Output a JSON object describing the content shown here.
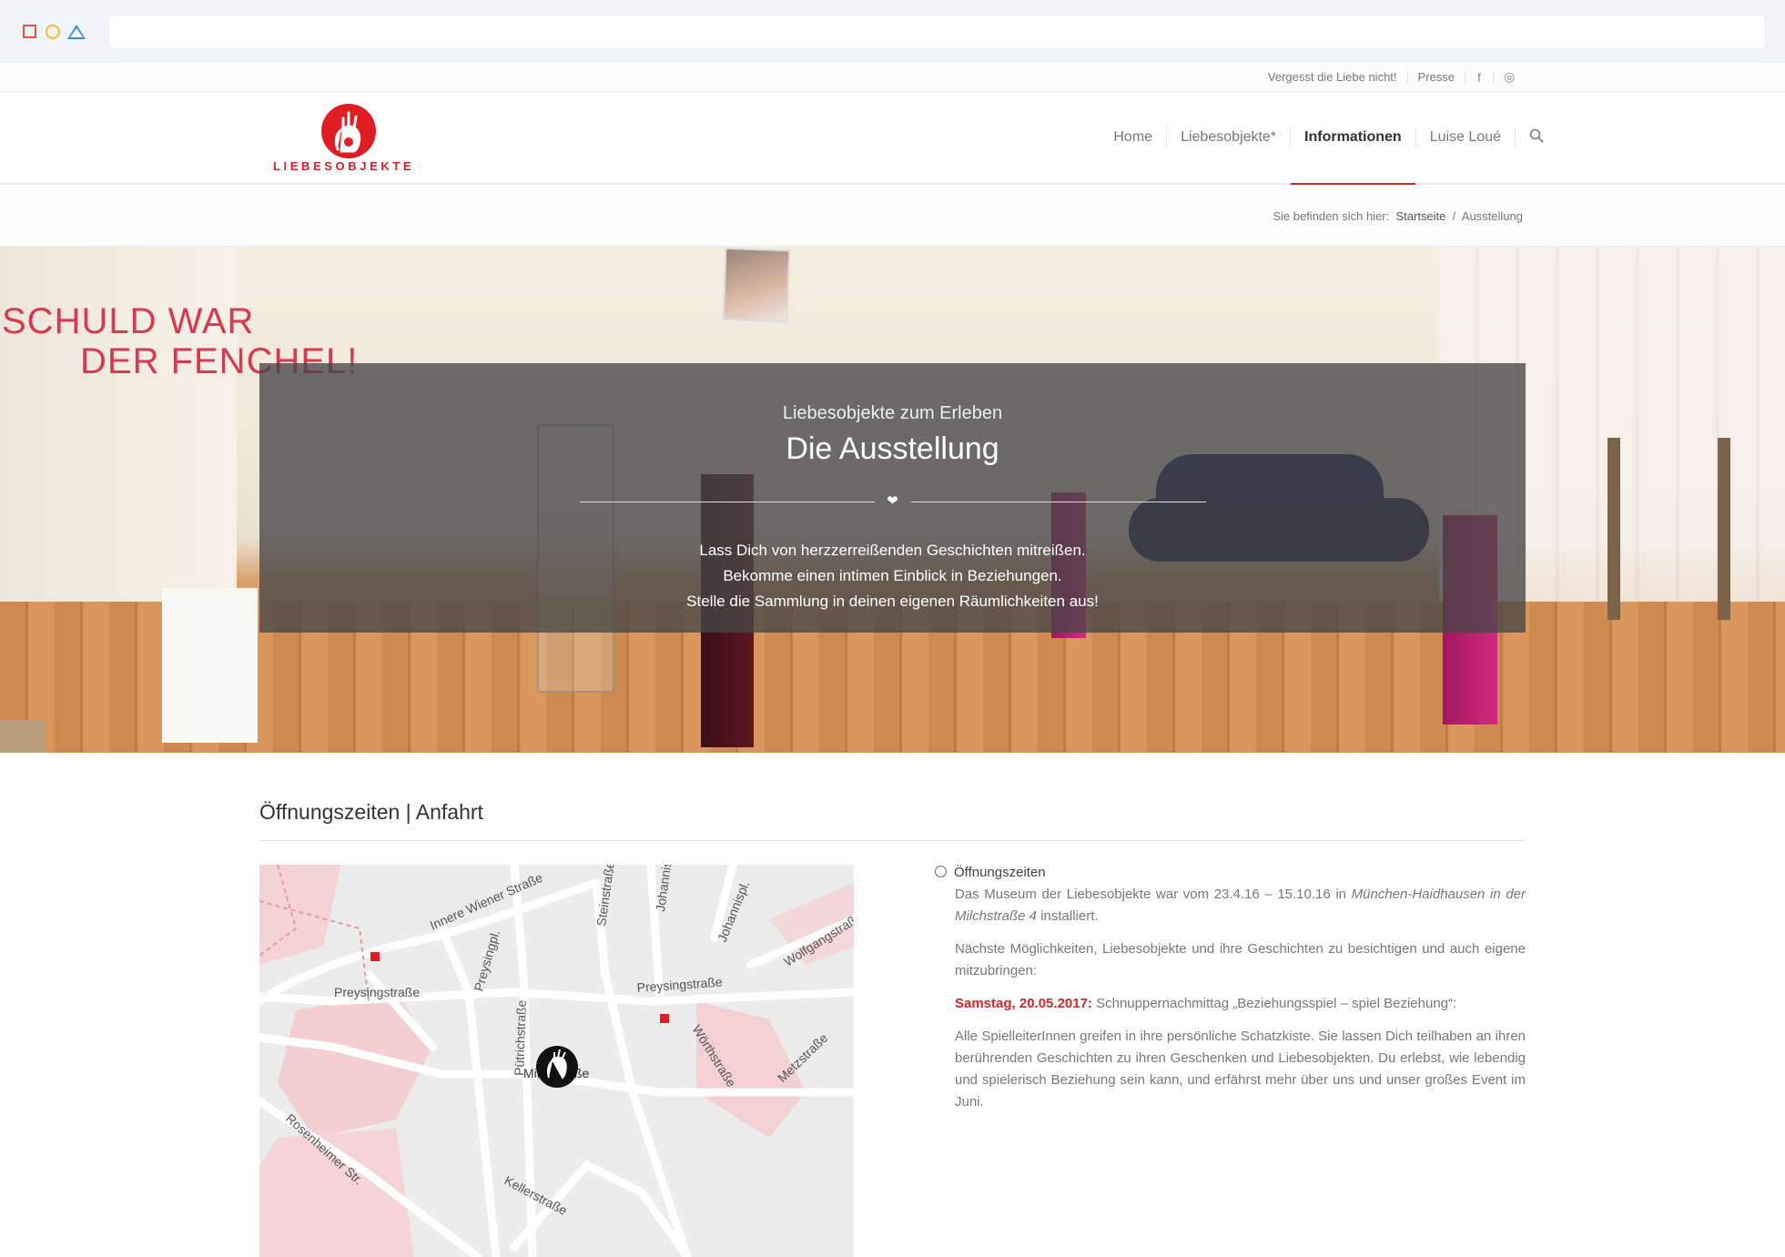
{
  "topbar": {
    "link1": "Vergesst die Liebe nicht!",
    "link2": "Presse",
    "fb": "f",
    "ig": "◎"
  },
  "logo": {
    "text": "LIEBESOBJEKTE"
  },
  "nav": {
    "home": "Home",
    "liebesobjekte": "Liebesobjekte*",
    "informationen": "Informationen",
    "luise": "Luise Loué",
    "search": "⚲"
  },
  "breadcrumb": {
    "prefix": "Sie befinden sich hier:",
    "home": "Startseite",
    "sep": "/",
    "current": "Ausstellung"
  },
  "hero": {
    "wall_text_1": "SCHULD WAR",
    "wall_text_2": "DER FENCHEL!",
    "subtitle": "Liebesobjekte zum Erleben",
    "title": "Die Ausstellung",
    "heart": "❤",
    "line1": "Lass Dich von herzzerreißenden Geschichten mitreißen.",
    "line2": "Bekomme einen intimen Einblick in Beziehungen.",
    "line3": "Stelle die Sammlung in deinen eigenen Räumlichkeiten aus!"
  },
  "section": {
    "title": "Öffnungszeiten | Anfahrt"
  },
  "map": {
    "streets": [
      "Innere Wiener Straße",
      "Steinstraße",
      "Johannisplatz",
      "Johannispl.",
      "Wolfgangstraße",
      "Preysingpl.",
      "Preysingstraße",
      "Preysingstraße",
      "Pütrichstraße",
      "Wörthstraße",
      "Metzstraße",
      "Rosenheimer Str.",
      "Kellerstraße",
      "Milchstraße"
    ]
  },
  "info": {
    "heading": "Öffnungszeiten",
    "p1_a": "Das Museum der Liebesobjekte war vom 23.4.16 – 15.10.16 in ",
    "p1_em": "München-Haidhausen in der Milchstraße 4",
    "p1_b": " installiert.",
    "p2": "Nächste Möglichkeiten, Liebesobjekte und ihre Geschichten zu besichtigen und auch eigene mitzubringen:",
    "p3_date": "Samstag, 20.05.2017:",
    "p3_text": " Schnuppernachmittag „Beziehungsspiel – spiel Beziehung“:",
    "p4": "Alle SpielleiterInnen greifen in ihre persönliche Schatzkiste. Sie lassen Dich teilhaben an ihren berührenden Geschichten zu ihren Geschenken und Liebesobjekten. Du erlebst, wie lebendig und spielerisch Beziehung sein kann, und erfährst mehr über uns und unser großes Event im Juni."
  },
  "colors": {
    "accent": "#d2262b",
    "overlay": "#464646"
  }
}
